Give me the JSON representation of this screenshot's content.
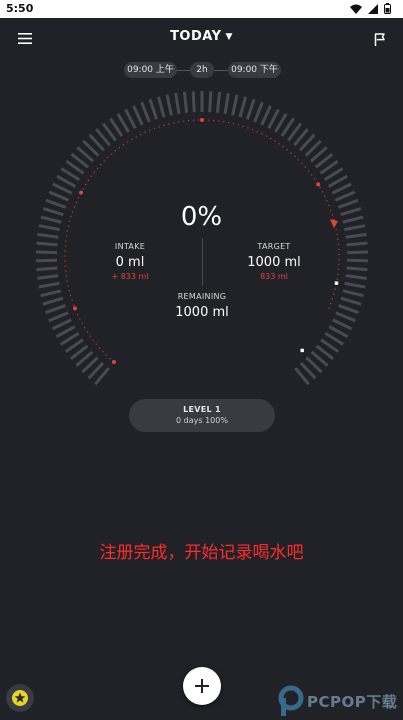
{
  "status_bar": {
    "time": "5:50"
  },
  "header": {
    "title": "TODAY"
  },
  "schedule": {
    "start": "09:00 上午",
    "interval": "2h",
    "end": "09:00 下午"
  },
  "progress": {
    "percent_label": "0%",
    "fraction": 0
  },
  "intake": {
    "label": "INTAKE",
    "value": "0 ml",
    "sub": "+ 833 ml"
  },
  "target": {
    "label": "TARGET",
    "value": "1000 ml",
    "sub": "833 ml"
  },
  "remaining": {
    "label": "REMAINING",
    "value": "1000 ml"
  },
  "level": {
    "title": "LEVEL 1",
    "sub": "0 days 100%"
  },
  "message": "注册完成，开始记录喝水吧",
  "fab": {
    "icon": "plus-icon"
  },
  "watermark": {
    "text": "PCPOP下载"
  },
  "colors": {
    "background": "#212227",
    "accent": "#e0433c",
    "ring": "#4a4b52",
    "pill": "#3a3b42"
  }
}
